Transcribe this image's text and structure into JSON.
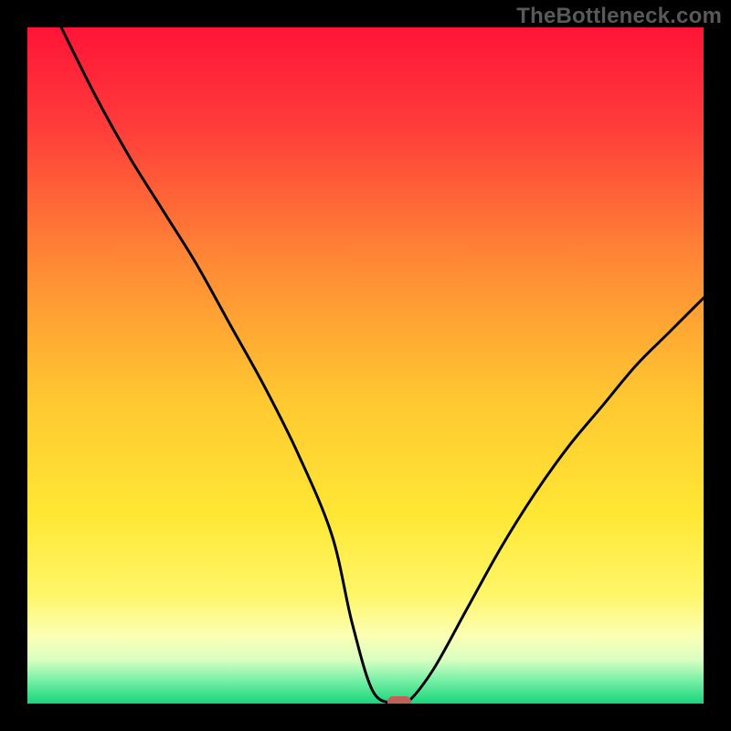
{
  "watermark": "TheBottleneck.com",
  "chart_data": {
    "type": "line",
    "title": "",
    "xlabel": "",
    "ylabel": "",
    "xlim": [
      0,
      100
    ],
    "ylim": [
      0,
      100
    ],
    "note": "V-shaped bottleneck curve displayed over a vertical red→yellow→green gradient. No numeric axes are shown; values below are visual estimates from the plot (x and y as percentages of the plot area, y=0 at bottom).",
    "series": [
      {
        "name": "bottleneck-curve",
        "x": [
          5,
          10,
          15,
          20,
          25,
          30,
          35,
          40,
          45,
          48,
          51,
          54,
          56,
          60,
          65,
          70,
          75,
          80,
          85,
          90,
          95,
          100
        ],
        "y": [
          100,
          90,
          81,
          73,
          65,
          56,
          47,
          37,
          25,
          12,
          2,
          0,
          0,
          5,
          14,
          23,
          31,
          38,
          44,
          50,
          55,
          60
        ]
      }
    ],
    "markers": [
      {
        "name": "optimal-point",
        "x": 55,
        "y": 0,
        "color": "#c06058"
      }
    ],
    "gradient_stops": [
      {
        "offset": 0.0,
        "color": "#ff1438"
      },
      {
        "offset": 0.15,
        "color": "#ff3d3a"
      },
      {
        "offset": 0.35,
        "color": "#ff8a35"
      },
      {
        "offset": 0.55,
        "color": "#ffc831"
      },
      {
        "offset": 0.72,
        "color": "#ffe734"
      },
      {
        "offset": 0.84,
        "color": "#fff66a"
      },
      {
        "offset": 0.9,
        "color": "#fbffb4"
      },
      {
        "offset": 0.935,
        "color": "#d9ffc1"
      },
      {
        "offset": 0.965,
        "color": "#7af0a8"
      },
      {
        "offset": 1.0,
        "color": "#17d67a"
      }
    ]
  }
}
